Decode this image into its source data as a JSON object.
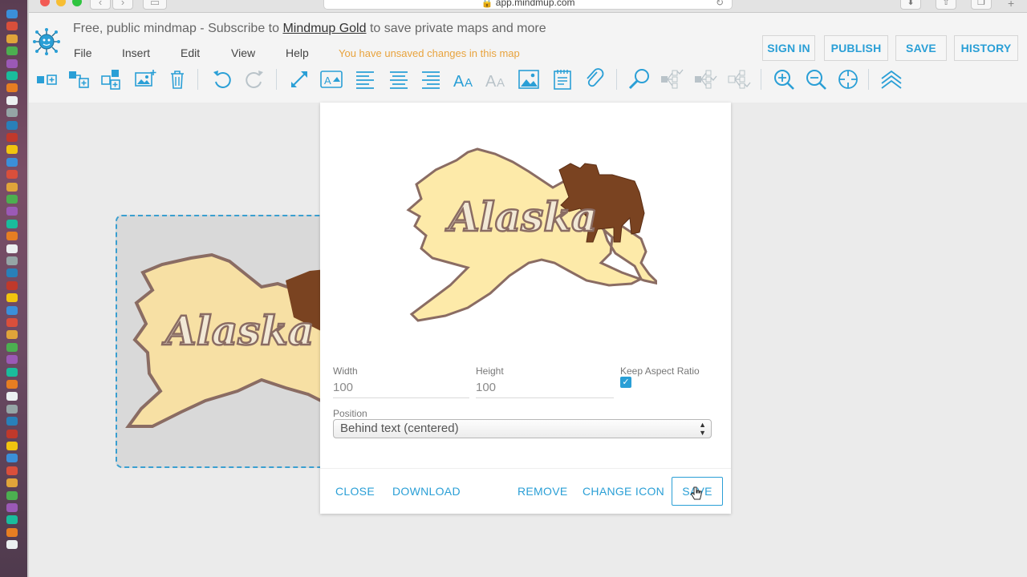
{
  "browser": {
    "url": "app.mindmup.com"
  },
  "app": {
    "banner": {
      "prefix": "Free, public mindmap - Subscribe to",
      "link": "Mindmup Gold",
      "suffix": "to save private maps and more"
    },
    "menu": [
      "File",
      "Insert",
      "Edit",
      "View",
      "Help"
    ],
    "unsaved_notice": "You have unsaved changes in this map",
    "top_buttons": {
      "sign_in": "SIGN IN",
      "publish": "PUBLISH",
      "save": "SAVE",
      "history": "HISTORY"
    },
    "toolbar_icons": [
      "add-child-icon",
      "add-sibling-icon",
      "add-parent-icon",
      "add-image-icon",
      "delete-icon",
      "undo-icon",
      "redo-icon",
      "connect-icon",
      "edit-text-icon",
      "align-left-icon",
      "align-center-icon",
      "align-right-icon",
      "font-larger-icon",
      "font-smaller-icon",
      "image-icon",
      "note-icon",
      "link-icon",
      "find-icon",
      "collapse-icon",
      "expand-icon",
      "toggle-icon",
      "zoom-in-icon",
      "zoom-out-icon",
      "reset-view-icon",
      "layers-icon"
    ],
    "accent_color": "#2a9fd6",
    "warning_color": "#e8a33d"
  },
  "node": {
    "image_text": "Alaska"
  },
  "dialog": {
    "preview_text": "Alaska",
    "width_label": "Width",
    "width_value": "100",
    "height_label": "Height",
    "height_value": "100",
    "aspect_label": "Keep Aspect Ratio",
    "aspect_checked": true,
    "position_label": "Position",
    "position_value": "Behind text (centered)",
    "buttons": {
      "close": "CLOSE",
      "download": "DOWNLOAD",
      "remove": "REMOVE",
      "change_icon": "CHANGE ICON",
      "save": "SAVE"
    }
  }
}
